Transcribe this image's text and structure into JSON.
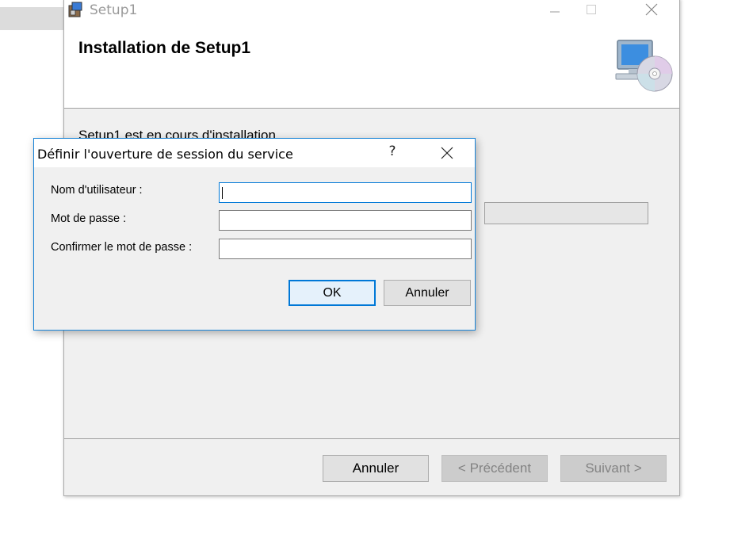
{
  "main_window": {
    "title": "Setup1",
    "header_title": "Installation de Setup1",
    "installing_text": "Setup1 est en cours d'installation...",
    "buttons": {
      "cancel": "Annuler",
      "previous": "< Précédent",
      "next": "Suivant >"
    },
    "title_icons": [
      "minimize-icon",
      "maximize-icon",
      "close-icon"
    ],
    "header_image": "computer-cd-icon"
  },
  "dialog": {
    "title": "Définir l'ouverture de session du service",
    "help_label": "?",
    "fields": [
      {
        "label": "Nom d'utilisateur :",
        "value": "",
        "placeholder": ""
      },
      {
        "label": "Mot de passe :",
        "value": "",
        "placeholder": ""
      },
      {
        "label": "Confirmer le mot de passe :",
        "value": "",
        "placeholder": ""
      }
    ],
    "buttons": {
      "ok": "OK",
      "cancel": "Annuler"
    }
  },
  "colors": {
    "accent": "#0078d7",
    "window_bg": "#f0f0f0",
    "disabled_text": "#838383"
  }
}
